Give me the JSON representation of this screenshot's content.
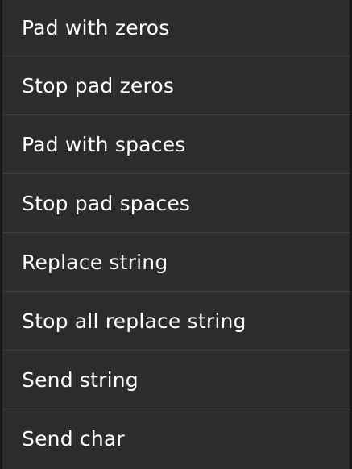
{
  "menu": {
    "items": [
      {
        "label": "Pad with zeros"
      },
      {
        "label": "Stop pad zeros"
      },
      {
        "label": "Pad with spaces"
      },
      {
        "label": "Stop pad spaces"
      },
      {
        "label": "Replace string"
      },
      {
        "label": "Stop all replace string"
      },
      {
        "label": "Send string"
      },
      {
        "label": "Send char"
      }
    ]
  },
  "colors": {
    "background": "#2c2c2c",
    "divider": "#3e3e3e",
    "text": "#ffffff"
  }
}
